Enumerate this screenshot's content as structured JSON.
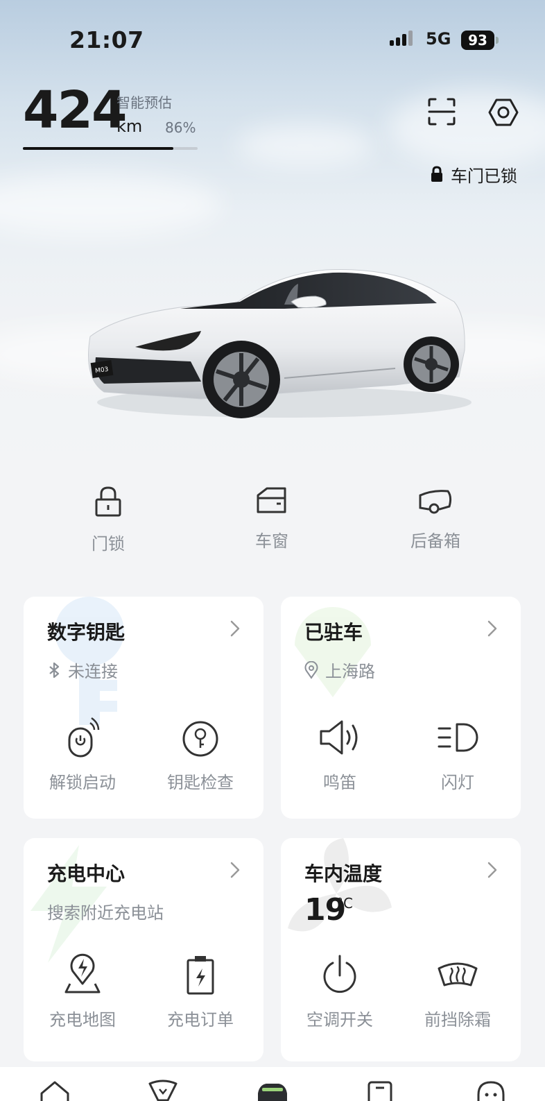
{
  "status_bar": {
    "time": "21:07",
    "network": "5G",
    "battery": "93"
  },
  "range": {
    "value": "424",
    "unit": "km",
    "label": "智能预估",
    "percent": "86%",
    "percent_value": 0.86
  },
  "top_actions": {
    "scan_icon": "scan-icon",
    "settings_icon": "settings-icon"
  },
  "door_status": {
    "icon": "lock-icon",
    "text": "车门已锁"
  },
  "car_image": {
    "plate": "M03"
  },
  "quick_controls": [
    {
      "label": "门锁",
      "icon": "padlock-icon"
    },
    {
      "label": "车窗",
      "icon": "window-icon"
    },
    {
      "label": "后备箱",
      "icon": "trunk-icon"
    }
  ],
  "cards": {
    "digital_key": {
      "title": "数字钥匙",
      "status": "未连接",
      "status_icon": "bluetooth-icon",
      "actions": [
        {
          "label": "解锁启动",
          "icon": "unlock-start-icon"
        },
        {
          "label": "钥匙检查",
          "icon": "key-check-icon"
        }
      ]
    },
    "parking": {
      "title": "已驻车",
      "location": "上海路",
      "location_icon": "location-pin-icon",
      "actions": [
        {
          "label": "鸣笛",
          "icon": "horn-icon"
        },
        {
          "label": "闪灯",
          "icon": "headlight-icon"
        }
      ]
    },
    "charging": {
      "title": "充电中心",
      "subtitle": "搜索附近充电站",
      "actions": [
        {
          "label": "充电地图",
          "icon": "charging-map-icon"
        },
        {
          "label": "充电订单",
          "icon": "charging-order-icon"
        }
      ]
    },
    "cabin_temp": {
      "title": "车内温度",
      "value": "19",
      "unit": "°C",
      "actions": [
        {
          "label": "空调开关",
          "icon": "power-icon"
        },
        {
          "label": "前挡除霜",
          "icon": "defrost-icon"
        }
      ]
    }
  },
  "tab_bar": [
    {
      "icon": "home-icon"
    },
    {
      "icon": "discover-icon"
    },
    {
      "icon": "car-icon"
    },
    {
      "icon": "shop-icon"
    },
    {
      "icon": "chat-icon"
    }
  ],
  "colors": {
    "background": "#f3f4f6",
    "card": "#ffffff",
    "text": "#1a1a1a",
    "muted": "#8b9097",
    "accent_green": "#9bd37a"
  }
}
